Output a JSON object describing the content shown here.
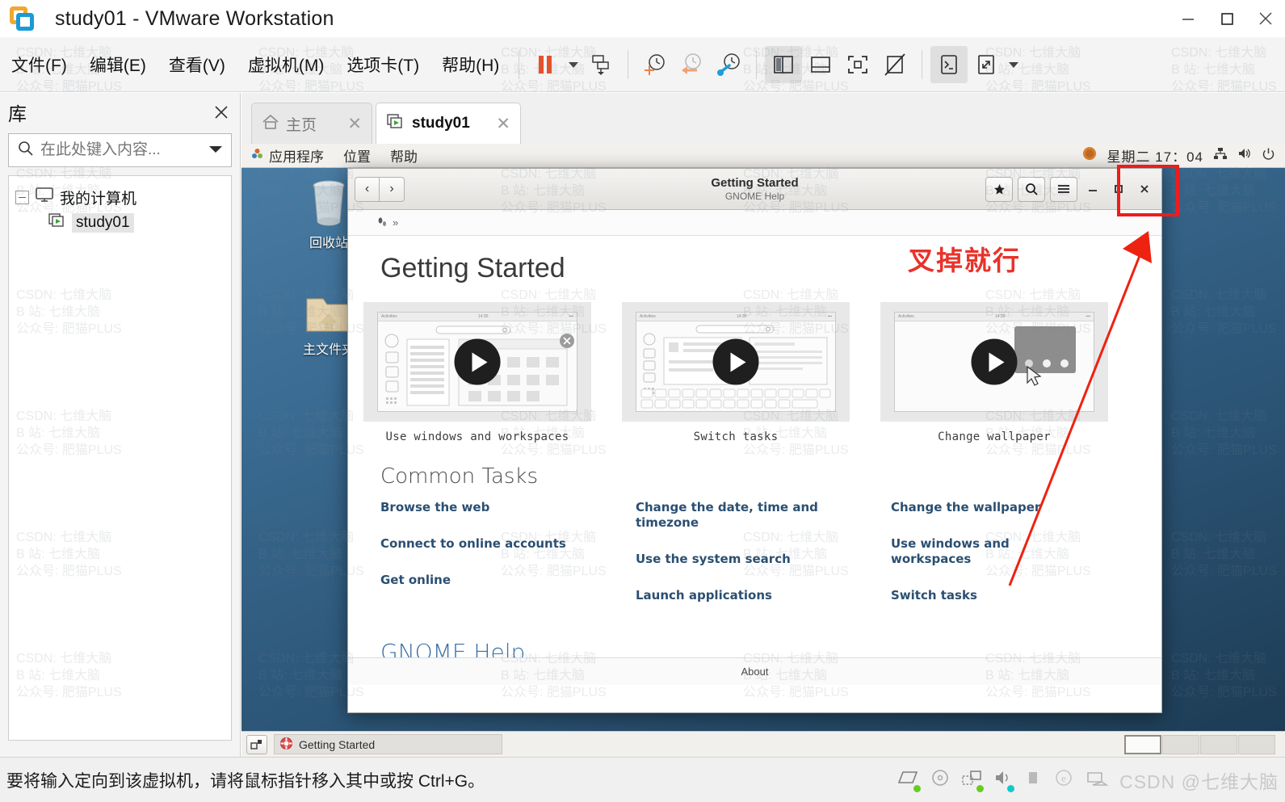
{
  "window": {
    "title": "study01 - VMware Workstation",
    "logo_icon": "vmware-logo-icon",
    "minimize_icon": "minimize-icon",
    "maximize_icon": "maximize-icon",
    "close_icon": "close-icon"
  },
  "menubar": {
    "items": [
      {
        "label": "文件(F)",
        "name": "menu-file"
      },
      {
        "label": "编辑(E)",
        "name": "menu-edit"
      },
      {
        "label": "查看(V)",
        "name": "menu-view"
      },
      {
        "label": "虚拟机(M)",
        "name": "menu-vm"
      },
      {
        "label": "选项卡(T)",
        "name": "menu-tabs"
      },
      {
        "label": "帮助(H)",
        "name": "menu-help"
      }
    ]
  },
  "toolbar": {
    "buttons": [
      {
        "name": "suspend-icon",
        "title": "挂起"
      },
      {
        "name": "power-dropdown-caret-icon",
        "title": "电源"
      },
      {
        "name": "snapshot-manage-icon",
        "title": "管理快照"
      },
      {
        "name": "take-snapshot-icon",
        "title": "拍摄快照"
      },
      {
        "name": "revert-snapshot-icon",
        "title": "恢复快照"
      },
      {
        "name": "snapshot-manager-icon",
        "title": "快照管理器"
      },
      {
        "name": "show-library-icon",
        "title": "显示或隐藏库"
      },
      {
        "name": "show-thumbnail-bar-icon",
        "title": "显示或隐藏缩略图栏"
      },
      {
        "name": "fullscreen-icon",
        "title": "进入全屏"
      },
      {
        "name": "unity-mode-icon",
        "title": "Unity 模式"
      },
      {
        "name": "console-icon",
        "title": "控制台视图"
      },
      {
        "name": "stretch-icon",
        "title": "自由拉伸"
      },
      {
        "name": "stretch-dropdown-caret-icon",
        "title": "拉伸选项"
      }
    ]
  },
  "library": {
    "title": "库",
    "close_icon": "close-icon",
    "search": {
      "icon": "search-icon",
      "placeholder": "在此处键入内容...",
      "value": "",
      "dropdown_icon": "chevron-down-icon"
    },
    "tree": [
      {
        "label": "我的计算机",
        "icon": "computer-icon",
        "expanded": true,
        "name": "tree-node-my-computer"
      },
      {
        "label": "study01",
        "icon": "vm-icon",
        "selected": true,
        "name": "tree-node-study01"
      }
    ]
  },
  "tabs": [
    {
      "label": "主页",
      "icon": "home-icon",
      "active": false,
      "close_icon": "close-icon",
      "name": "tab-home"
    },
    {
      "label": "study01",
      "icon": "vm-icon",
      "active": true,
      "close_icon": "close-icon",
      "name": "tab-study01"
    }
  ],
  "guest": {
    "panel": {
      "applications": "应用程序",
      "places": "位置",
      "help": "帮助",
      "apps_icon": "gnome-applications-icon",
      "clock": "星期二 17：04",
      "network_icon": "network-icon",
      "volume_icon": "volume-icon",
      "power_icon": "power-icon",
      "user_icon": "user-avatar-icon"
    },
    "desktop_icons": [
      {
        "label": "回收站",
        "name": "desktop-icon-trash"
      },
      {
        "label": "主文件夹",
        "name": "desktop-icon-home"
      }
    ],
    "taskbar": {
      "workspace_switcher_icon": "workspace-switcher-icon",
      "task_label": "Getting Started",
      "task_icon": "help-lifering-icon",
      "workspaces": 4,
      "current_workspace": 1
    }
  },
  "yelp": {
    "header": {
      "back_icon": "chevron-left-icon",
      "forward_icon": "chevron-right-icon",
      "title": "Getting Started",
      "subtitle": "GNOME Help",
      "bookmark_icon": "star-icon",
      "search_icon": "search-icon",
      "menu_icon": "hamburger-menu-icon",
      "minimize_icon": "minimize-icon",
      "maximize_icon": "maximize-icon",
      "close_icon": "close-icon"
    },
    "breadcrumb_icon": "footsteps-icon",
    "breadcrumb_more": "»",
    "page_title": "Getting Started",
    "videos": [
      {
        "caption": "Use windows and workspaces",
        "mini_time": "14:30",
        "play_icon": "play-icon",
        "name": "video-card-windows-workspaces"
      },
      {
        "caption": "Switch tasks",
        "mini_time": "14:30",
        "play_icon": "play-icon",
        "name": "video-card-switch-tasks"
      },
      {
        "caption": "Change wallpaper",
        "mini_time": "14:30",
        "play_icon": "play-icon",
        "name": "video-card-change-wallpaper"
      }
    ],
    "common_tasks_title": "Common Tasks",
    "common_tasks": [
      [
        "Browse the web",
        "Connect to online accounts",
        "Get online"
      ],
      [
        "Change the date, time and timezone",
        "Use the system search",
        "Launch applications"
      ],
      [
        "Change the wallpaper",
        "Use windows and workspaces",
        "Switch tasks"
      ]
    ],
    "gnome_help_title": "GNOME Help",
    "about": "About"
  },
  "annotation": {
    "text": "叉掉就行",
    "color": "#e8332a",
    "arrow_name": "red-arrow-annotation",
    "box_name": "red-highlight-box"
  },
  "statusbar": {
    "text": "要将输入定向到该虚拟机，请将鼠标指针移入其中或按 Ctrl+G。",
    "icons": [
      {
        "name": "hard-disk-icon",
        "dot": "#66cc22"
      },
      {
        "name": "cd-dvd-icon",
        "dot": ""
      },
      {
        "name": "network-adapter-icon",
        "dot": "#66cc22"
      },
      {
        "name": "sound-card-icon",
        "dot": "#13c8c8"
      },
      {
        "name": "usb-icon",
        "dot": ""
      },
      {
        "name": "printer-icon",
        "dot": ""
      },
      {
        "name": "display-icon",
        "dot": ""
      }
    ],
    "csdn_watermark": "CSDN @七维大脑"
  },
  "watermark": {
    "lines": [
      "CSDN: 七维大脑",
      "B  站: 七维大脑",
      "公众号: 肥猫PLUS"
    ]
  }
}
